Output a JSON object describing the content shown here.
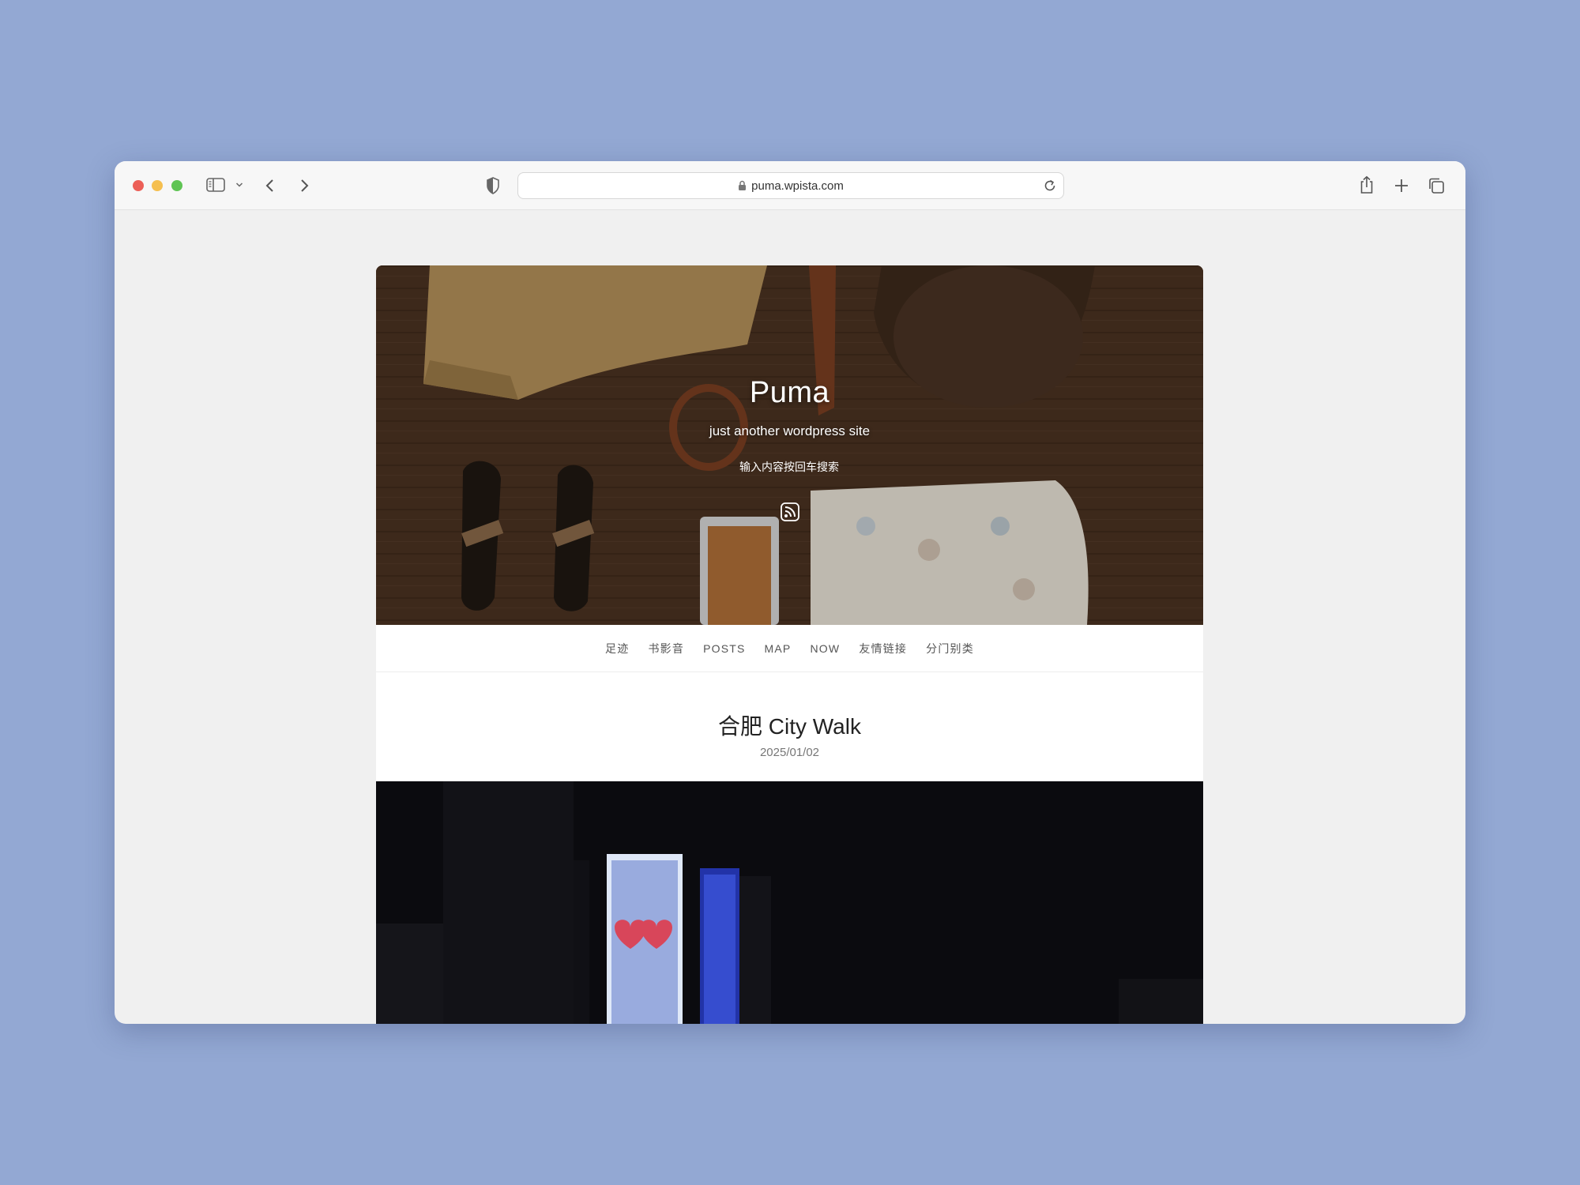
{
  "browser": {
    "url": "puma.wpista.com"
  },
  "site": {
    "title": "Puma",
    "tagline": "just another wordpress site",
    "search_placeholder": "输入内容按回车搜索"
  },
  "nav": {
    "items": [
      "足迹",
      "书影音",
      "POSTS",
      "MAP",
      "NOW",
      "友情链接",
      "分门别类"
    ]
  },
  "post": {
    "title": "合肥 City Walk",
    "date": "2025/01/02"
  },
  "icons": {
    "sidebar": "sidebar-icon",
    "back": "chevron-left-icon",
    "forward": "chevron-right-icon",
    "privacy": "shield-icon",
    "lock": "lock-icon",
    "reload": "reload-icon",
    "share": "share-icon",
    "new_tab": "plus-icon",
    "tabs": "tabs-overview-icon",
    "rss": "rss-icon"
  },
  "colors": {
    "background": "#93a8d3",
    "window": "#f0f0f0",
    "nav_text": "#555555"
  }
}
